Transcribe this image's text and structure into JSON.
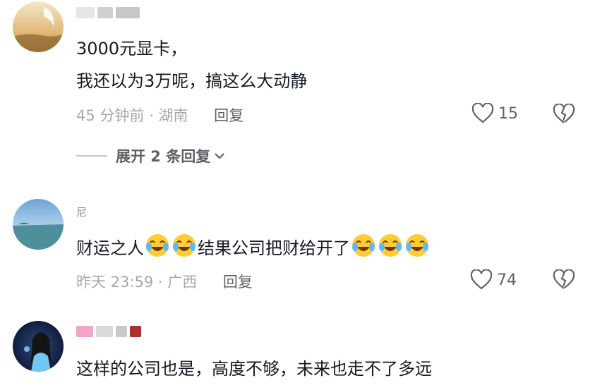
{
  "comments": [
    {
      "text_lines": [
        "3000元显卡，",
        "我还以为3万呢，搞这么大动静"
      ],
      "time": "45 分钟前 · 湖南",
      "reply_label": "回复",
      "likes": "15",
      "expand_label": "展开 2 条回复"
    },
    {
      "name_visible": "尼",
      "text_a": "财运之人",
      "text_b": "结果公司把财给开了",
      "time": "昨天 23:59 · 广西",
      "reply_label": "回复",
      "likes": "74"
    },
    {
      "text": "这样的公司也是，高度不够，未来也走不了多远"
    }
  ],
  "colors": {
    "text": "#161823",
    "meta": "#a6a8ad",
    "action": "#5f6168"
  },
  "icons": [
    "heart-outline-icon",
    "broken-heart-icon",
    "chevron-down-icon",
    "crying-laughing-emoji"
  ]
}
